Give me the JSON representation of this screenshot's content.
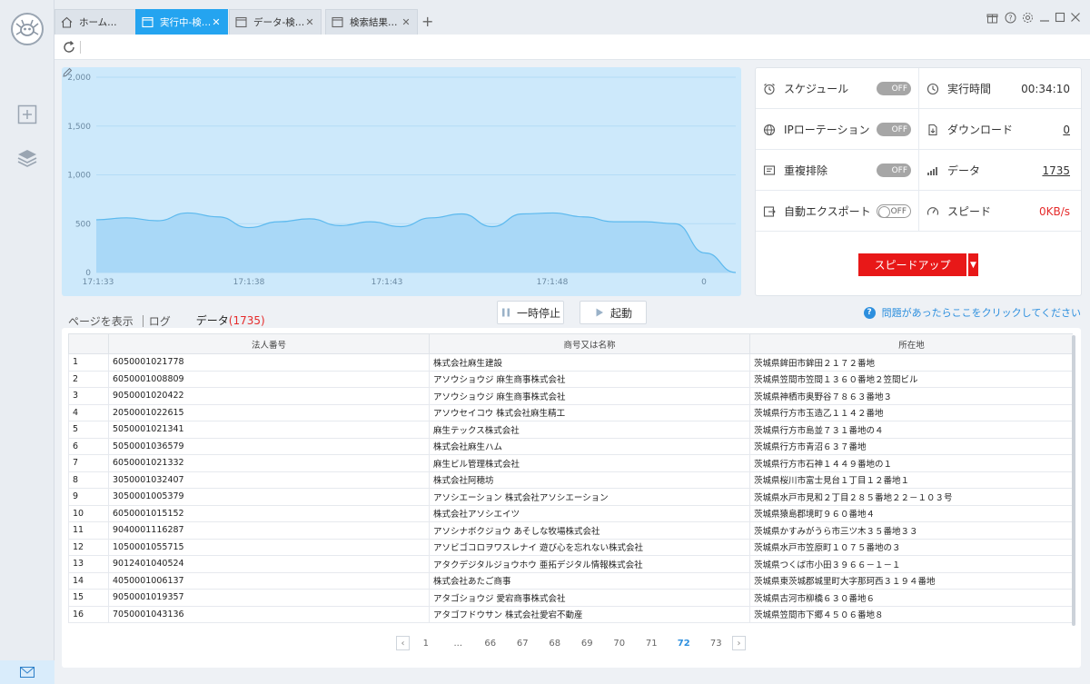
{
  "tabs": [
    {
      "label": "ホーム…",
      "icon": "home-icon",
      "active": false
    },
    {
      "label": "実行中-検…",
      "icon": "window-icon",
      "active": true
    },
    {
      "label": "データ-検…",
      "icon": "window-icon",
      "active": false
    },
    {
      "label": "検索結果…",
      "icon": "window-icon",
      "active": false
    }
  ],
  "chart_data": {
    "type": "area",
    "y_ticks": [
      "2,000",
      "1,500",
      "1,000",
      "500",
      "0"
    ],
    "ylim": [
      0,
      2000
    ],
    "x_ticks": [
      "17:1:33",
      "17:1:38",
      "17:1:43",
      "17:1:48",
      "0"
    ],
    "x": [
      0,
      1,
      2,
      3,
      4,
      5,
      6,
      7,
      8,
      9,
      10,
      11,
      12,
      13,
      14,
      15,
      16,
      17,
      18,
      19,
      20,
      21
    ],
    "values": [
      540,
      560,
      530,
      610,
      570,
      460,
      520,
      550,
      480,
      520,
      470,
      560,
      600,
      470,
      600,
      610,
      570,
      520,
      520,
      500,
      200,
      0
    ],
    "grid": true,
    "fill": "#a9d8f7",
    "stroke": "#5cb9ee"
  },
  "stats": {
    "schedule_label": "スケジュール",
    "schedule_toggle": "OFF",
    "runtime_label": "実行時間",
    "runtime_value": "00:34:10",
    "ip_label": "IPローテーション",
    "ip_toggle": "OFF",
    "download_label": "ダウンロード",
    "download_value": "0",
    "dedup_label": "重複排除",
    "dedup_toggle": "OFF",
    "data_label": "データ",
    "data_value": "1735",
    "export_label": "自動エクスポート",
    "export_toggle": "OFF",
    "speed_label": "スピード",
    "speed_value": "0KB/s",
    "speedup_label": "スピードアップ"
  },
  "controls": {
    "view_page": "ページを表示",
    "view_log": "ログ",
    "view_data": "データ",
    "data_count": "(1735)",
    "pause_label": "一時停止",
    "start_label": "起動",
    "help_text": "問題があったらここをクリックしてください"
  },
  "table": {
    "headers": [
      "法人番号",
      "商号又は名称",
      "所在地"
    ],
    "rows": [
      [
        "1",
        "6050001021778",
        "株式会社麻生建設",
        "茨城県鉾田市鉾田２１７２番地"
      ],
      [
        "2",
        "6050001008809",
        "アソウショウジ 麻生商事株式会社",
        "茨城県笠間市笠間１３６０番地２笠間ビル"
      ],
      [
        "3",
        "9050001020422",
        "アソウショウジ 麻生商事株式会社",
        "茨城県神栖市奥野谷７８６３番地３"
      ],
      [
        "4",
        "2050001022615",
        "アソウセイコウ 株式会社麻生精工",
        "茨城県行方市玉造乙１１４２番地"
      ],
      [
        "5",
        "5050001021341",
        "麻生テックス株式会社",
        "茨城県行方市島並７３１番地の４"
      ],
      [
        "6",
        "5050001036579",
        "株式会社麻生ハム",
        "茨城県行方市青沼６３７番地"
      ],
      [
        "7",
        "6050001021332",
        "麻生ビル管理株式会社",
        "茨城県行方市石神１４４９番地の１"
      ],
      [
        "8",
        "3050001032407",
        "株式会社阿穂坊",
        "茨城県桜川市富士見台１丁目１２番地１"
      ],
      [
        "9",
        "3050001005379",
        "アソシエーション 株式会社アソシエーション",
        "茨城県水戸市見和２丁目２８５番地２２－１０３号"
      ],
      [
        "10",
        "6050001015152",
        "株式会社アソシエイツ",
        "茨城県猿島郡境町９６０番地４"
      ],
      [
        "11",
        "9040001116287",
        "アソシナボクジョウ あそしな牧場株式会社",
        "茨城県かすみがうら市三ツ木３５番地３３"
      ],
      [
        "12",
        "1050001055715",
        "アソビゴコロヲワスレナイ 遊び心を忘れない株式会社",
        "茨城県水戸市笠原町１０７５番地の３"
      ],
      [
        "13",
        "9012401040524",
        "アタクデジタルジョウホウ 亜拓デジタル情報株式会社",
        "茨城県つくば市小田３９６６－１－１"
      ],
      [
        "14",
        "4050001006137",
        "株式会社あたご商事",
        "茨城県東茨城郡城里町大字那珂西３１９４番地"
      ],
      [
        "15",
        "9050001019357",
        "アタゴショウジ 愛宕商事株式会社",
        "茨城県古河市柳橋６３０番地６"
      ],
      [
        "16",
        "7050001043136",
        "アタゴフドウサン 株式会社愛宕不動産",
        "茨城県笠間市下郷４５０６番地８"
      ]
    ]
  },
  "pager": {
    "pages": [
      "1",
      "...",
      "66",
      "67",
      "68",
      "69",
      "70",
      "71",
      "72",
      "73"
    ],
    "current": "72"
  }
}
